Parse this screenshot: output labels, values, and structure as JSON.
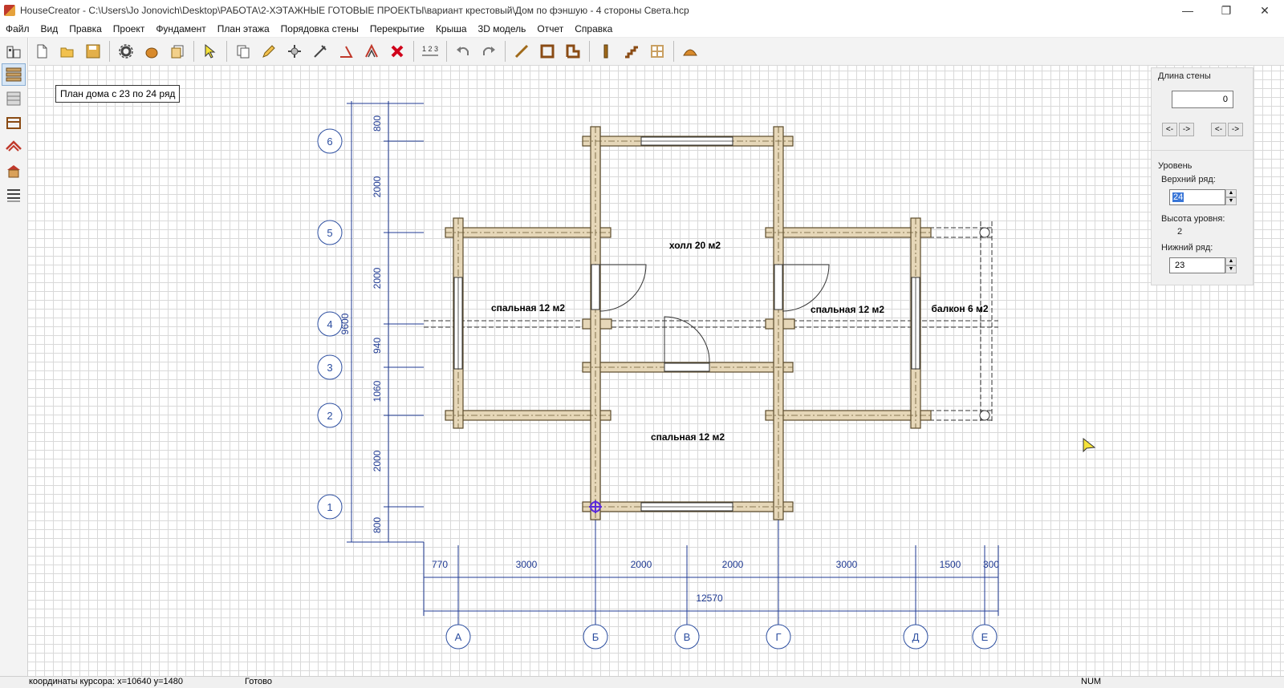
{
  "window": {
    "title": "HouseCreator - C:\\Users\\Jo Jonovich\\Desktop\\РАБОТА\\2-ХЭТАЖНЫЕ ГОТОВЫЕ ПРОЕКТЫ\\вариант крестовый\\Дом по фэншую - 4 стороны Света.hcp",
    "minimize": "—",
    "restore": "❐",
    "close": "✕"
  },
  "menu": [
    "Файл",
    "Вид",
    "Правка",
    "Проект",
    "Фундамент",
    "План этажа",
    "Порядовка стены",
    "Перекрытие",
    "Крыша",
    "3D модель",
    "Отчет",
    "Справка"
  ],
  "plan_label": "План дома с 23 по 24 ряд",
  "rooms": {
    "hall": "холл 20 м2",
    "bedroom_left": "спальная 12 м2",
    "bedroom_right": "спальная 12 м2",
    "bedroom_bottom": "спальная 12 м2",
    "balcony": "балкон 6 м2"
  },
  "axes_numeric": [
    "6",
    "5",
    "4",
    "3",
    "2",
    "1"
  ],
  "axes_letters": [
    "А",
    "Б",
    "В",
    "Г",
    "Д",
    "Е"
  ],
  "dims_vertical": [
    "800",
    "2000",
    "2000",
    "940",
    "1060",
    "2000",
    "800"
  ],
  "dim_vertical_total": "9600",
  "dims_horizontal": [
    "770",
    "3000",
    "2000",
    "2000",
    "3000",
    "1500",
    "300"
  ],
  "dim_horizontal_total": "12570",
  "right_panel": {
    "wall_length_label": "Длина стены",
    "wall_length_value": "0",
    "arrow_left": "<-",
    "arrow_right": "->",
    "level_label": "Уровень",
    "top_row_label": "Верхний ряд:",
    "top_row_value": "24",
    "level_height_label": "Высота уровня:",
    "level_height_value": "2",
    "bottom_row_label": "Нижний ряд:",
    "bottom_row_value": "23"
  },
  "status": {
    "cursor": "координаты курсора: x=10640 y=1480",
    "ready": "Готово",
    "num": "NUM"
  },
  "colors": {
    "log": "#e6d7b8",
    "log_border": "#5a4a2a",
    "dim_line": "#1f3a93",
    "axis_circle": "#2c4ea0"
  }
}
